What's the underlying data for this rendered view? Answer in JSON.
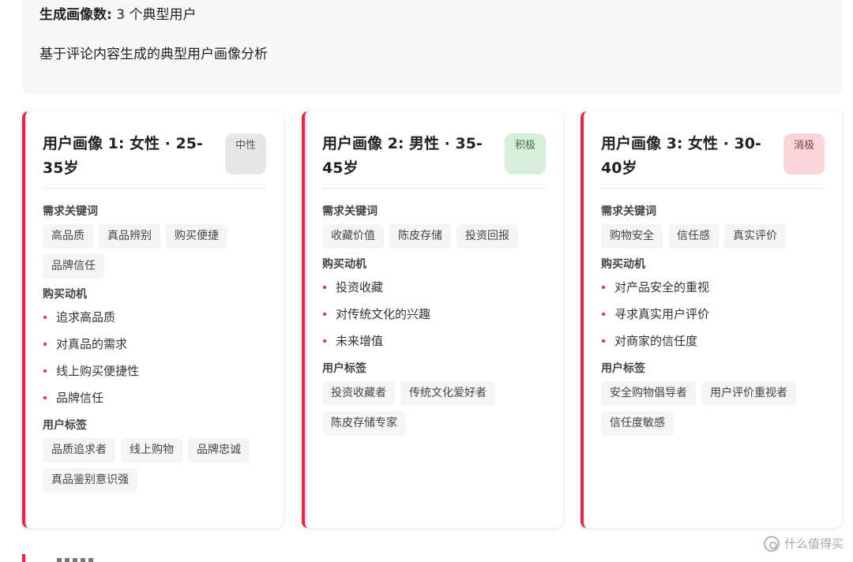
{
  "summary": {
    "count_label": "生成画像数:",
    "count_value": "3 个典型用户",
    "description": "基于评论内容生成的典型用户画像分析"
  },
  "colors": {
    "accent": "#f0233f",
    "neutral_badge": "#e6e7e9",
    "positive_badge": "#d7eedb",
    "negative_badge": "#f8d6da"
  },
  "personas": [
    {
      "title": "用户画像 1: 女性 · 25-35岁",
      "sentiment": "中性",
      "needs_title": "需求关键词",
      "needs": [
        "高品质",
        "真品辨别",
        "购买便捷",
        "品牌信任"
      ],
      "motives_title": "购买动机",
      "motives": [
        "追求高品质",
        "对真品的需求",
        "线上购买便捷性",
        "品牌信任"
      ],
      "tags_title": "用户标签",
      "tags": [
        "品质追求者",
        "线上购物",
        "品牌忠诚",
        "真品鉴别意识强"
      ]
    },
    {
      "title": "用户画像 2: 男性 · 35-45岁",
      "sentiment": "积极",
      "needs_title": "需求关键词",
      "needs": [
        "收藏价值",
        "陈皮存储",
        "投资回报"
      ],
      "motives_title": "购买动机",
      "motives": [
        "投资收藏",
        "对传统文化的兴趣",
        "未来增值"
      ],
      "tags_title": "用户标签",
      "tags": [
        "投资收藏者",
        "传统文化爱好者",
        "陈皮存储专家"
      ]
    },
    {
      "title": "用户画像 3: 女性 · 30-40岁",
      "sentiment": "消极",
      "needs_title": "需求关键词",
      "needs": [
        "购物安全",
        "信任感",
        "真实评价"
      ],
      "motives_title": "购买动机",
      "motives": [
        "对产品安全的重视",
        "寻求真实用户评价",
        "对商家的信任度"
      ],
      "tags_title": "用户标签",
      "tags": [
        "安全购物倡导者",
        "用户评价重视者",
        "信任度敏感"
      ]
    }
  ],
  "watermark": {
    "icon": "watermark-logo-icon",
    "text": "什么值得买"
  }
}
